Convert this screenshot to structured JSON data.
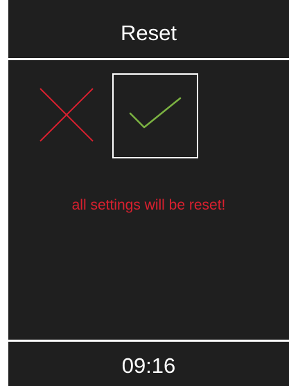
{
  "header": {
    "title": "Reset"
  },
  "options": {
    "cancel": {
      "icon": "cross-icon",
      "selected": false
    },
    "confirm": {
      "icon": "check-icon",
      "selected": true
    }
  },
  "message": {
    "text": "all settings will be reset!"
  },
  "footer": {
    "time": "09:16"
  },
  "colors": {
    "background": "#1f1f1f",
    "foreground": "#ffffff",
    "cancel": "#d9202f",
    "confirm": "#7cb342",
    "warning": "#d9202f"
  }
}
